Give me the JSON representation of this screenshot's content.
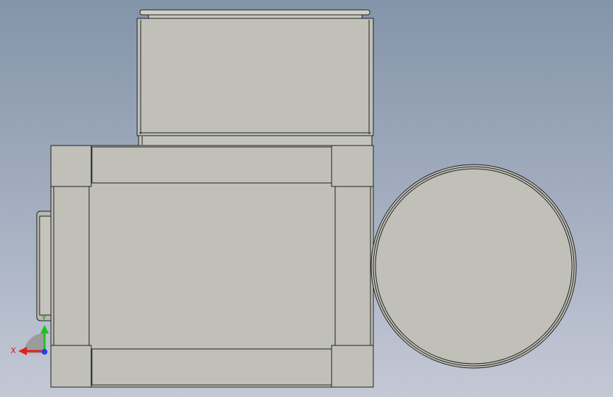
{
  "view": {
    "background_top": "#8494a9",
    "background_bottom": "#c4c8d5",
    "part_fill": "#c0c0b8",
    "edge_color": "#1e1e1e"
  },
  "triad": {
    "x_label": "X",
    "y_label": "Y",
    "x_color": "#e02020",
    "y_color": "#20c020",
    "z_color": "#2040e0"
  }
}
